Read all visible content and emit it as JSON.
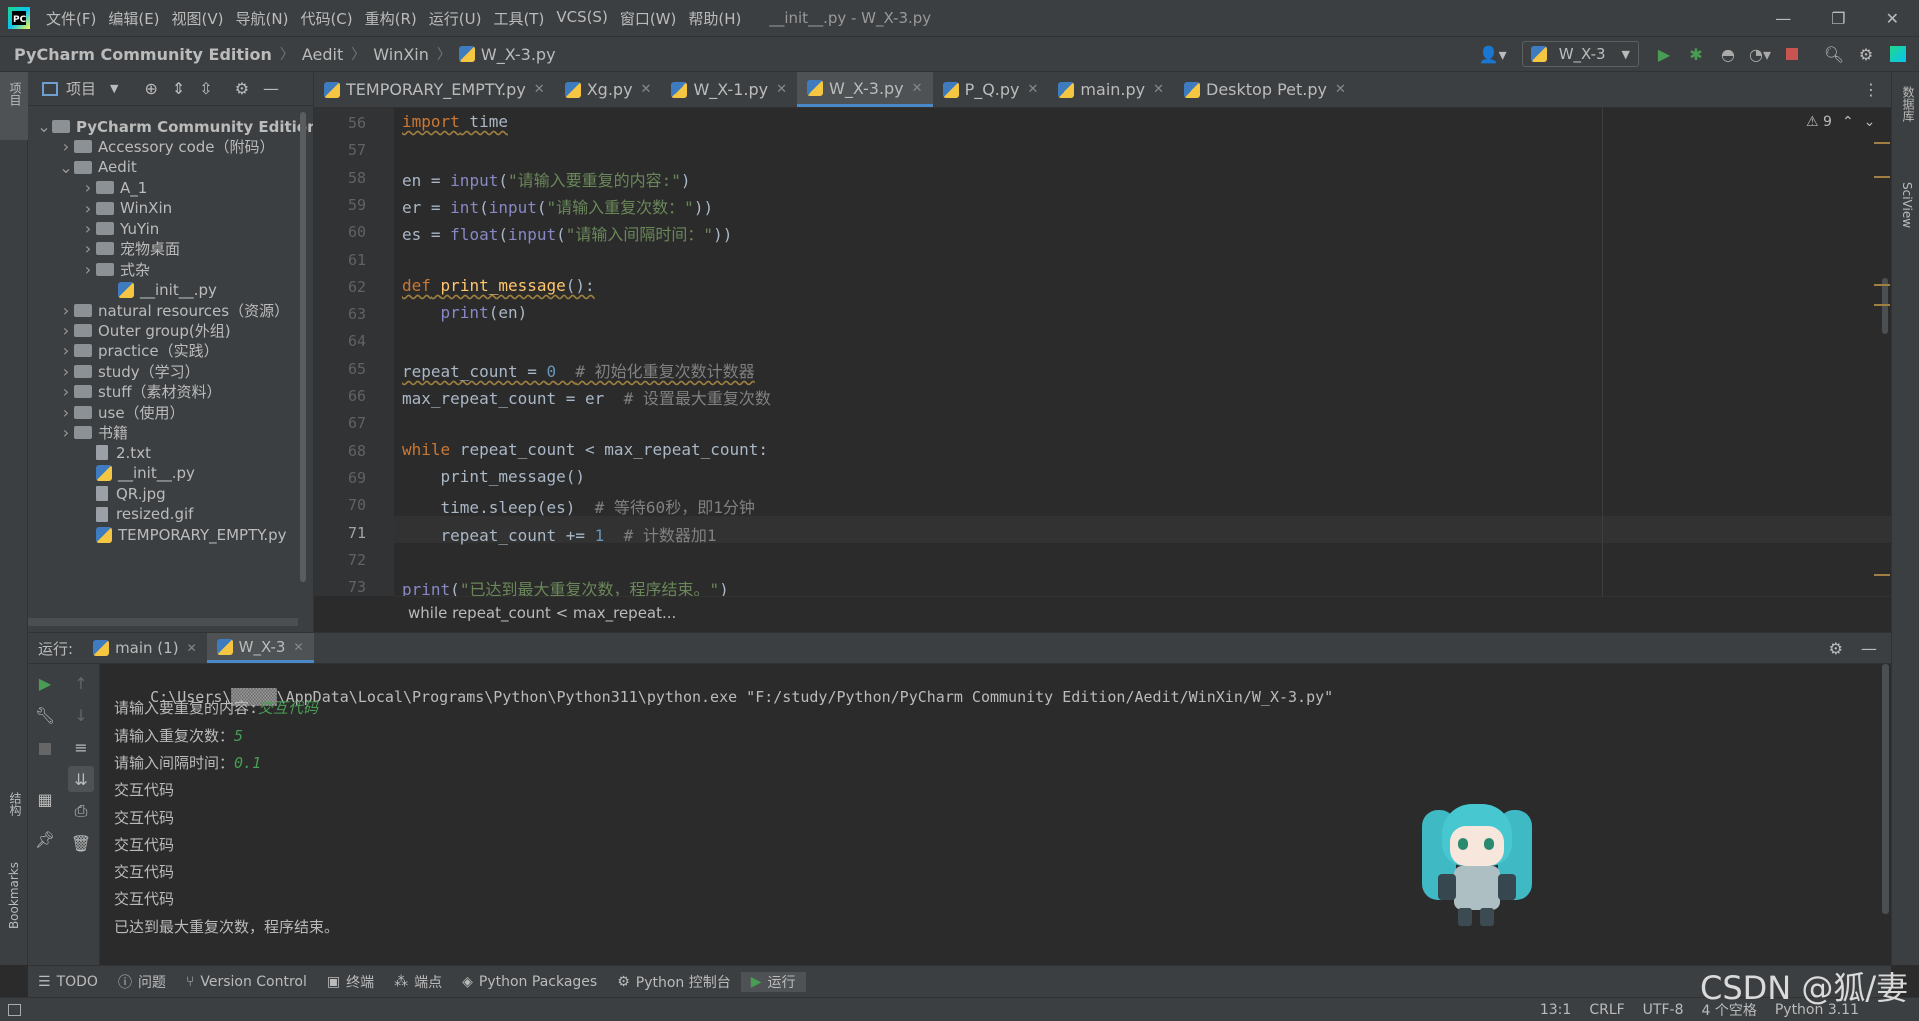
{
  "window": {
    "title": "__init__.py - W_X-3.py"
  },
  "menu": [
    "文件(F)",
    "编辑(E)",
    "视图(V)",
    "导航(N)",
    "代码(C)",
    "重构(R)",
    "运行(U)",
    "工具(T)",
    "VCS(S)",
    "窗口(W)",
    "帮助(H)"
  ],
  "breadcrumb": [
    "PyCharm Community Edition",
    "Aedit",
    "WinXin",
    "W_X-3.py"
  ],
  "run_config": "W_X-3",
  "left_strip": {
    "project": "项目",
    "structure": "结构",
    "bookmarks": "Bookmarks"
  },
  "right_strip": {
    "database": "数据库",
    "sciview": "SciView"
  },
  "project_panel": {
    "title": "项目"
  },
  "tree": [
    {
      "label": "PyCharm Community Edition",
      "depth": 0,
      "kind": "folder",
      "open": true,
      "bold": true
    },
    {
      "label": "Accessory code（附码）",
      "depth": 1,
      "kind": "folder",
      "open": false
    },
    {
      "label": "Aedit",
      "depth": 1,
      "kind": "folder",
      "open": true
    },
    {
      "label": "A_1",
      "depth": 2,
      "kind": "folder",
      "open": false
    },
    {
      "label": "WinXin",
      "depth": 2,
      "kind": "folder",
      "open": false
    },
    {
      "label": "YuYin",
      "depth": 2,
      "kind": "folder",
      "open": false
    },
    {
      "label": "宠物桌面",
      "depth": 2,
      "kind": "folder",
      "open": false
    },
    {
      "label": "式杂",
      "depth": 2,
      "kind": "folder",
      "open": false
    },
    {
      "label": "__init__.py",
      "depth": 3,
      "kind": "py"
    },
    {
      "label": "natural resources（资源）",
      "depth": 1,
      "kind": "folder",
      "open": false
    },
    {
      "label": "Outer group(外组)",
      "depth": 1,
      "kind": "folder",
      "open": false
    },
    {
      "label": "practice（实践）",
      "depth": 1,
      "kind": "folder",
      "open": false
    },
    {
      "label": "study（学习）",
      "depth": 1,
      "kind": "folder",
      "open": false
    },
    {
      "label": "stuff（素材资料）",
      "depth": 1,
      "kind": "folder",
      "open": false
    },
    {
      "label": "use（使用）",
      "depth": 1,
      "kind": "folder",
      "open": false
    },
    {
      "label": "书籍",
      "depth": 1,
      "kind": "folder",
      "open": false
    },
    {
      "label": "2.txt",
      "depth": 2,
      "kind": "file"
    },
    {
      "label": "__init__.py",
      "depth": 2,
      "kind": "py"
    },
    {
      "label": "QR.jpg",
      "depth": 2,
      "kind": "file"
    },
    {
      "label": "resized.gif",
      "depth": 2,
      "kind": "file"
    },
    {
      "label": "TEMPORARY_EMPTY.py",
      "depth": 2,
      "kind": "py"
    }
  ],
  "editor_tabs": [
    {
      "label": "TEMPORARY_EMPTY.py",
      "active": false
    },
    {
      "label": "Xg.py",
      "active": false
    },
    {
      "label": "W_X-1.py",
      "active": false
    },
    {
      "label": "W_X-3.py",
      "active": true
    },
    {
      "label": "P_Q.py",
      "active": false
    },
    {
      "label": "main.py",
      "active": false
    },
    {
      "label": "Desktop Pet.py",
      "active": false
    }
  ],
  "inspections": {
    "warnings": "9"
  },
  "code": {
    "line_numbers": [
      "56",
      "57",
      "58",
      "59",
      "60",
      "61",
      "62",
      "63",
      "64",
      "65",
      "66",
      "67",
      "68",
      "69",
      "70",
      "71",
      "72",
      "73"
    ],
    "current_line": "71"
  },
  "editor_breadcrumb": "while repeat_count < max_repeat...",
  "run": {
    "label": "运行:",
    "tabs": [
      {
        "label": "main (1)",
        "active": false
      },
      {
        "label": "W_X-3",
        "active": true
      }
    ],
    "command_prefix": "C:\\Users\\",
    "masked_user": "▒▒▒▒▒",
    "command_suffix": "\\AppData\\Local\\Programs\\Python\\Python311\\python.exe \"F:/study/Python/PyCharm Community Edition/Aedit/WinXin/W_X-3.py\"",
    "prompts": [
      {
        "prompt": "请输入要重复的内容:",
        "input": "交互代码"
      },
      {
        "prompt": "请输入重复次数：",
        "input": "5"
      },
      {
        "prompt": "请输入间隔时间：",
        "input": "0.1"
      }
    ],
    "outputs": [
      "交互代码",
      "交互代码",
      "交互代码",
      "交互代码",
      "交互代码"
    ],
    "final": "已达到最大重复次数，程序结束。"
  },
  "bottom_tabs": [
    {
      "label": "TODO",
      "icon": "list-icon",
      "active": false
    },
    {
      "label": "问题",
      "icon": "info-icon",
      "active": false
    },
    {
      "label": "Version Control",
      "icon": "vcs-icon",
      "active": false
    },
    {
      "label": "终端",
      "icon": "terminal-icon",
      "active": false
    },
    {
      "label": "端点",
      "icon": "endpoint-icon",
      "active": false
    },
    {
      "label": "Python Packages",
      "icon": "packages-icon",
      "active": false
    },
    {
      "label": "Python 控制台",
      "icon": "console-icon",
      "active": false
    },
    {
      "label": "运行",
      "icon": "run-icon",
      "active": true
    }
  ],
  "status": {
    "position": "13:1",
    "line_sep": "CRLF",
    "encoding": "UTF-8",
    "indent": "4 个空格",
    "interpreter": "Python 3.11"
  },
  "watermark": "CSDN @狐/妻",
  "colors": {
    "accent": "#4a88c7",
    "run_green": "#499c54",
    "stop_red": "#c75450"
  }
}
